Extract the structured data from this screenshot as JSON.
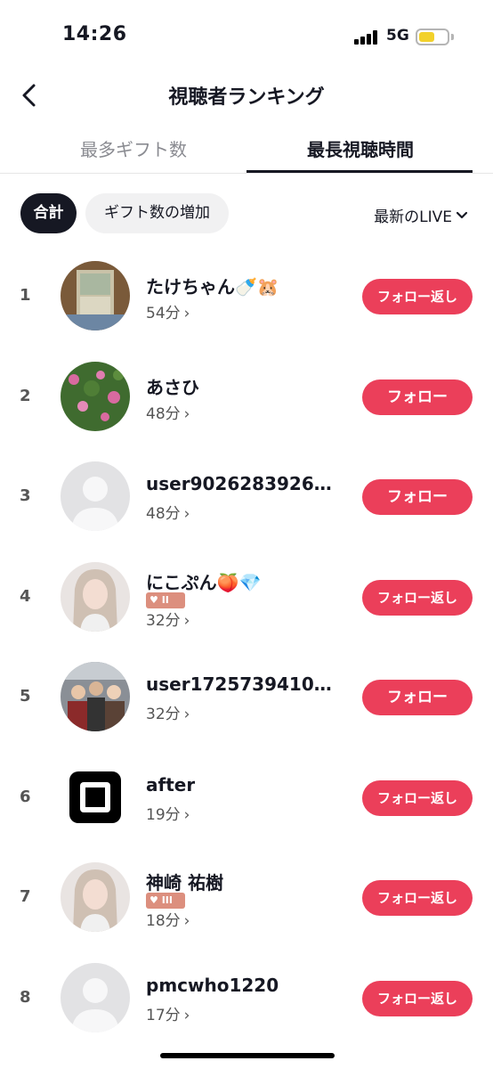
{
  "status_bar": {
    "time": "14:26",
    "network": "5G",
    "battery_level": 0.55
  },
  "header": {
    "title": "視聴者ランキング",
    "back_icon": "chevron-left-icon"
  },
  "tabs": [
    {
      "label": "最多ギフト数",
      "active": false
    },
    {
      "label": "最長視聴時間",
      "active": true
    }
  ],
  "filters": {
    "chips": [
      {
        "label": "合計",
        "active": true
      },
      {
        "label": "ギフト数の増加",
        "active": false
      }
    ],
    "live_select": "最新のLIVE"
  },
  "viewers": [
    {
      "rank": "1",
      "name": "たけちゃん🍼🐹",
      "badge": "",
      "duration": "54分",
      "action": "フォロー返し",
      "avatar": "photo-room"
    },
    {
      "rank": "2",
      "name": "あさひ",
      "badge": "",
      "duration": "48分",
      "action": "フォロー",
      "avatar": "photo-flowers"
    },
    {
      "rank": "3",
      "name": "user90262839267...",
      "badge": "",
      "duration": "48分",
      "action": "フォロー",
      "avatar": "default-user"
    },
    {
      "rank": "4",
      "name": "にこぷん🍑💎",
      "badge": "II",
      "duration": "32分",
      "action": "フォロー返し",
      "avatar": "photo-person"
    },
    {
      "rank": "5",
      "name": "user1725739410246",
      "badge": "",
      "duration": "32分",
      "action": "フォロー",
      "avatar": "photo-group"
    },
    {
      "rank": "6",
      "name": "after",
      "badge": "",
      "duration": "19分",
      "action": "フォロー返し",
      "avatar": "square-logo"
    },
    {
      "rank": "7",
      "name": "神崎 祐樹",
      "badge": "III",
      "duration": "18分",
      "action": "フォロー返し",
      "avatar": "photo-person"
    },
    {
      "rank": "8",
      "name": "pmcwho1220",
      "badge": "",
      "duration": "17分",
      "action": "フォロー返し",
      "avatar": "default-user"
    }
  ],
  "colors": {
    "follow_button": "#eb3f5a",
    "active_chip": "#161823",
    "badge": "#dc8f7e"
  }
}
